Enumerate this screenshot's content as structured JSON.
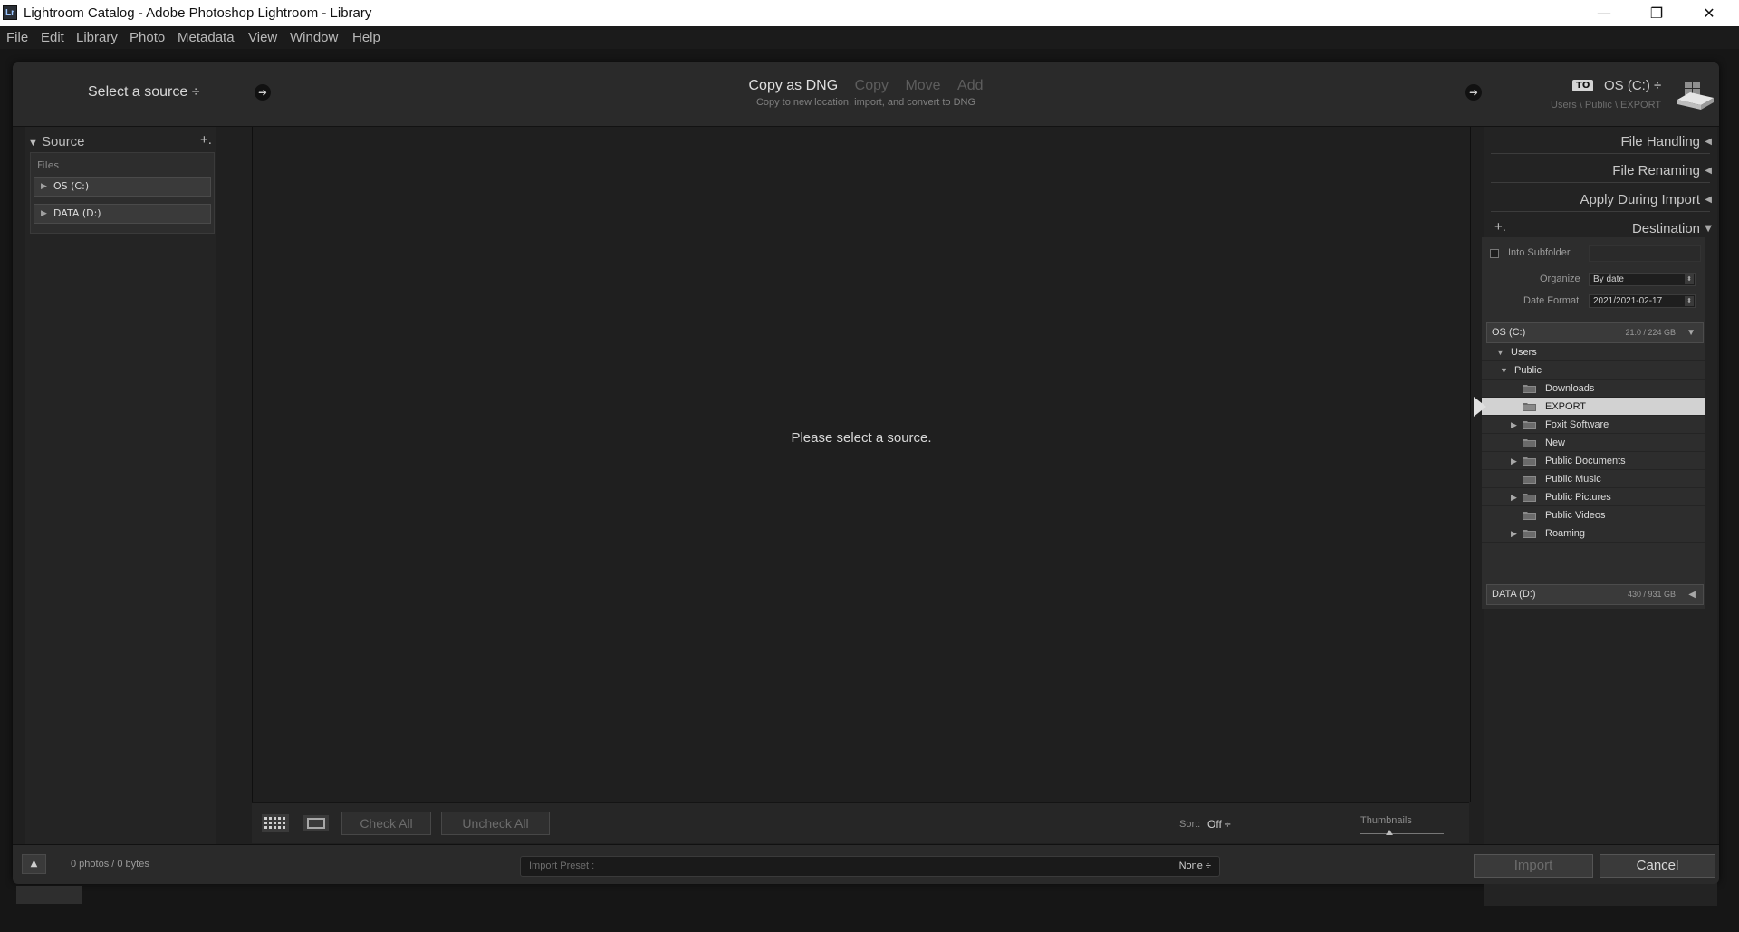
{
  "window": {
    "app_icon_text": "Lr",
    "title": "Lightroom Catalog - Adobe Photoshop Lightroom - Library",
    "minimize": "—",
    "maximize": "❐",
    "close": "✕"
  },
  "menu": [
    "File",
    "Edit",
    "Library",
    "Photo",
    "Metadata",
    "View",
    "Window",
    "Help"
  ],
  "import_header": {
    "select_source": "Select a source ÷",
    "modes": [
      {
        "label": "Copy as DNG",
        "active": true
      },
      {
        "label": "Copy",
        "active": false
      },
      {
        "label": "Move",
        "active": false
      },
      {
        "label": "Add",
        "active": false
      }
    ],
    "mode_description": "Copy to new location, import, and convert to DNG",
    "to_badge": "TO",
    "destination_drive": "OS (C:) ÷",
    "destination_path": "Users \\ Public \\ EXPORT"
  },
  "source_panel": {
    "title": "Source",
    "add_icon": "+.",
    "files_label": "Files",
    "drives": [
      "OS (C:)",
      "DATA (D:)"
    ]
  },
  "grid": {
    "empty_message": "Please select a source."
  },
  "toolbar": {
    "check_all": "Check All",
    "uncheck_all": "Uncheck All",
    "sort_label": "Sort:",
    "sort_value": "Off ÷",
    "thumbnails_label": "Thumbnails",
    "thumbnail_size_fraction": 0.35
  },
  "right_panel": {
    "sections": [
      "File Handling",
      "File Renaming",
      "Apply During Import"
    ],
    "destination_title": "Destination",
    "destination_add_icon": "+.",
    "into_subfolder_label": "Into Subfolder",
    "organize_label": "Organize",
    "organize_value": "By date",
    "date_format_label": "Date Format",
    "date_format_value": "2021/2021-02-17",
    "volumes": [
      {
        "name": "OS (C:)",
        "size": "21.0 / 224 GB"
      },
      {
        "name": "DATA (D:)",
        "size": "430 / 931 GB"
      }
    ],
    "tree_users": "Users",
    "tree_public": "Public",
    "folders": [
      {
        "name": "Downloads",
        "expandable": false,
        "selected": false
      },
      {
        "name": "EXPORT",
        "expandable": false,
        "selected": true
      },
      {
        "name": "Foxit Software",
        "expandable": true,
        "selected": false
      },
      {
        "name": "New",
        "expandable": false,
        "selected": false
      },
      {
        "name": "Public Documents",
        "expandable": true,
        "selected": false
      },
      {
        "name": "Public Music",
        "expandable": false,
        "selected": false
      },
      {
        "name": "Public Pictures",
        "expandable": true,
        "selected": false
      },
      {
        "name": "Public Videos",
        "expandable": false,
        "selected": false
      },
      {
        "name": "Roaming",
        "expandable": true,
        "selected": false
      }
    ]
  },
  "bottom_bar": {
    "photo_count": "0 photos / 0 bytes",
    "import_preset_label": "Import Preset :",
    "import_preset_value": "None ÷",
    "import_button": "Import",
    "cancel_button": "Cancel"
  }
}
